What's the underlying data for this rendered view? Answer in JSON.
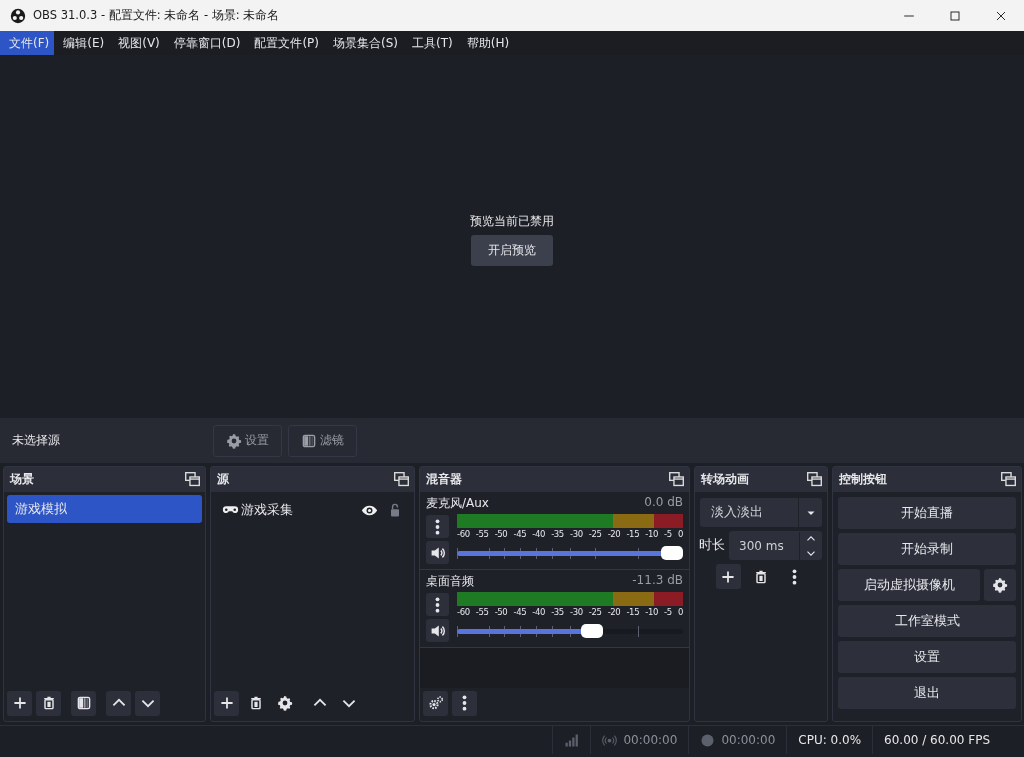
{
  "window": {
    "title": "OBS 31.0.3 - 配置文件: 未命名 - 场景: 未命名"
  },
  "menu": [
    {
      "label": "文件(F)",
      "selected": true
    },
    {
      "label": "编辑(E)",
      "selected": false
    },
    {
      "label": "视图(V)",
      "selected": false
    },
    {
      "label": "停靠窗口(D)",
      "selected": false
    },
    {
      "label": "配置文件(P)",
      "selected": false
    },
    {
      "label": "场景集合(S)",
      "selected": false
    },
    {
      "label": "工具(T)",
      "selected": false
    },
    {
      "label": "帮助(H)",
      "selected": false
    }
  ],
  "preview": {
    "message": "预览当前已禁用",
    "button": "开启预览"
  },
  "context_bar": {
    "label": "未选择源",
    "buttons": [
      {
        "label": "设置",
        "kind": "settings"
      },
      {
        "label": "滤镜",
        "kind": "filters"
      }
    ]
  },
  "scenes": {
    "title": "场景",
    "items": [
      {
        "label": "游戏模拟",
        "selected": true
      }
    ]
  },
  "sources": {
    "title": "源",
    "items": [
      {
        "label": "游戏采集",
        "visible": true,
        "locked": false
      }
    ]
  },
  "mixer": {
    "title": "混音器",
    "channels": [
      {
        "name": "麦克风/Aux",
        "reading": "0.0 dB",
        "level": 1.0,
        "scale": [
          "-60",
          "-55",
          "-50",
          "-45",
          "-40",
          "-35",
          "-30",
          "-25",
          "-20",
          "-15",
          "-10",
          "-5",
          "0"
        ]
      },
      {
        "name": "桌面音频",
        "reading": "-11.3 dB",
        "level": 0.61,
        "scale": [
          "-60",
          "-55",
          "-50",
          "-45",
          "-40",
          "-35",
          "-30",
          "-25",
          "-20",
          "-15",
          "-10",
          "-5",
          "0"
        ]
      }
    ]
  },
  "transitions": {
    "title": "转场动画",
    "selected": "淡入淡出",
    "duration_label": "时长",
    "duration": "300 ms"
  },
  "controls": {
    "title": "控制按钮",
    "buttons": [
      {
        "label": "开始直播",
        "kind": "plain"
      },
      {
        "label": "开始录制",
        "kind": "plain"
      },
      {
        "label": "启动虚拟摄像机",
        "kind": "with-gear"
      },
      {
        "label": "工作室模式",
        "kind": "plain"
      },
      {
        "label": "设置",
        "kind": "plain"
      },
      {
        "label": "退出",
        "kind": "plain"
      }
    ]
  },
  "status_bar": {
    "stream_time": "00:00:00",
    "record_time": "00:00:00",
    "cpu": "CPU: 0.0%",
    "fps": "60.00 / 60.00 FPS"
  }
}
